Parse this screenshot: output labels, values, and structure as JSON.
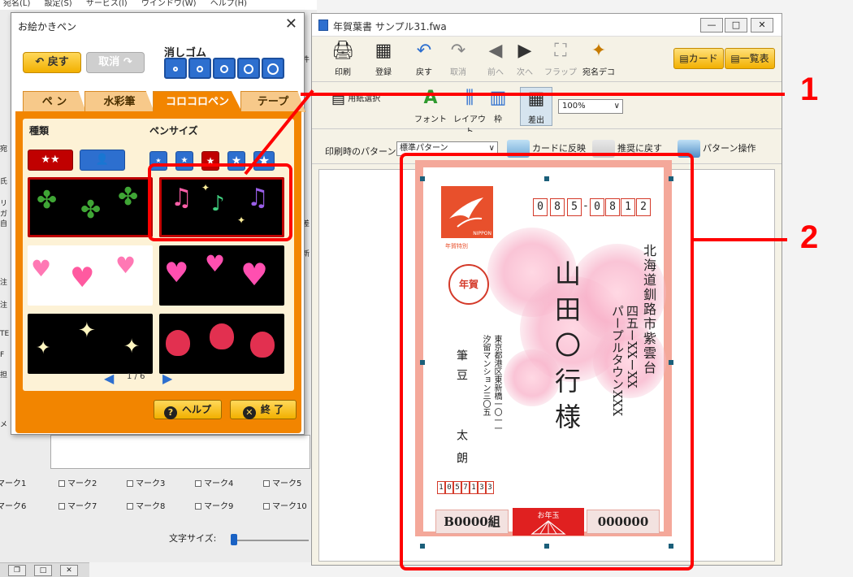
{
  "bg_app": {
    "menubar": [
      "宛名(L)",
      "設定(S)",
      "サービス(I)",
      "ウインドウ(W)",
      "ヘルプ(H)"
    ],
    "marks_row1": [
      "マーク1",
      "マーク2",
      "マーク3",
      "マーク4",
      "マーク5"
    ],
    "marks_row2": [
      "マーク6",
      "マーク7",
      "マーク8",
      "マーク9",
      "マーク10"
    ],
    "text_size_label": "文字サイズ:",
    "left_edge_fragments": [
      "宛",
      "氏",
      "リガ",
      "自",
      "注",
      "注",
      "TE",
      "F",
      "担",
      "メ",
      "件",
      "差",
      "新"
    ]
  },
  "pen_dialog": {
    "title": "お絵かきペン",
    "back_label": "戻す",
    "cancel_label": "取消",
    "eraser_label": "消しゴム",
    "tabs": [
      "ペ ン",
      "水彩筆",
      "コロコロペン",
      "テープ"
    ],
    "active_tab": "コロコロペン",
    "type_label": "種類",
    "pen_size_label": "ペンサイズ",
    "thumbnails": [
      {
        "name": "clover",
        "selected": false
      },
      {
        "name": "music-notes",
        "selected": true
      },
      {
        "name": "pink-hearts",
        "selected": false
      },
      {
        "name": "glossy-hearts",
        "selected": false
      },
      {
        "name": "sparkles",
        "selected": false
      },
      {
        "name": "strawberries",
        "selected": false
      }
    ],
    "page_indicator": "1 / 6",
    "help_label": "ヘルプ",
    "end_label": "終 了",
    "accent_color": "#f28500"
  },
  "main_window": {
    "title": "年賀葉書  サンプル31.fwa",
    "toolbar1": [
      {
        "label": "印刷",
        "icon": "printer-icon",
        "enabled": true
      },
      {
        "label": "登録",
        "icon": "register-icon",
        "enabled": true
      },
      {
        "label": "戻す",
        "icon": "undo-icon",
        "enabled": true
      },
      {
        "label": "取消",
        "icon": "redo-icon",
        "enabled": false
      },
      {
        "label": "前へ",
        "icon": "prev-icon",
        "enabled": false
      },
      {
        "label": "次へ",
        "icon": "next-icon",
        "enabled": false
      },
      {
        "label": "フラップ",
        "icon": "flap-icon",
        "enabled": false
      },
      {
        "label": "宛名デコ",
        "icon": "address-deco-icon",
        "enabled": true
      }
    ],
    "card_button": "カード",
    "list_button": "一覧表",
    "toolbar2": [
      {
        "label": "用紙選択",
        "icon": "paper-select-icon"
      },
      {
        "label": "フォント",
        "icon": "font-icon"
      },
      {
        "label": "レイアウト",
        "icon": "layout-icon"
      },
      {
        "label": "枠",
        "icon": "frame-icon"
      },
      {
        "label": "差出",
        "icon": "sender-icon"
      }
    ],
    "zoom": "100%",
    "pattern_label": "印刷時のパターン",
    "pattern_value": "標準パターン",
    "reflect_label": "カードに反映",
    "recommend_label": "推奨に戻す",
    "pattern_op_label": "パターン操作"
  },
  "postcard": {
    "postcode_digits": [
      "0",
      "8",
      "5",
      "0",
      "8",
      "1",
      "2"
    ],
    "postcode_dash": "-",
    "nenga": "年賀",
    "stamp_text": "NIPPON",
    "stamp_sub": "年賀特別",
    "address_line1": "北海道釧路市紫雲台",
    "address_line2": "四五ーXXーXX",
    "address_line3": "パープルタウンXXX",
    "recipient": "山田〇行様",
    "sender_address_line1": "東京都港区東新橋一〇一一",
    "sender_address_line2": "汐留マンション三〇五",
    "sender_company": "筆豆",
    "sender_name": "太朗",
    "sender_postcode": [
      "1",
      "0",
      "5",
      "7",
      "1",
      "3",
      "3"
    ],
    "lottery_group": "B0000組",
    "lottery_number": "000000",
    "otoshidama": "お年玉"
  },
  "annotations": {
    "label_1": "1",
    "label_2": "2",
    "color": "#ff0000"
  }
}
